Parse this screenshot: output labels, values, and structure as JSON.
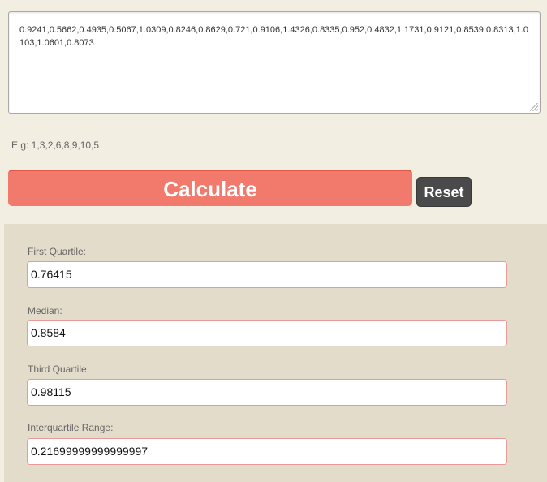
{
  "input": {
    "value": "0.9241,0.5662,0.4935,0.5067,1.0309,0.8246,0.8629,0.721,0.9106,1.4326,0.8335,0.952,0.4832,1.1731,0.9121,0.8539,0.8313,1.0103,1.0601,0.8073"
  },
  "example_text": "E.g: 1,3,2,6,8,9,10,5",
  "buttons": {
    "calculate": "Calculate",
    "reset": "Reset"
  },
  "results": [
    {
      "label": "First Quartile:",
      "value": "0.76415"
    },
    {
      "label": "Median:",
      "value": "0.8584"
    },
    {
      "label": "Third Quartile:",
      "value": "0.98115"
    },
    {
      "label": "Interquartile Range:",
      "value": "0.21699999999999997"
    }
  ],
  "colors": {
    "calculate_bg": "#f27a6c",
    "reset_bg": "#4a4a4a",
    "results_bg": "#e4dccb",
    "page_bg": "#f3eee2"
  }
}
